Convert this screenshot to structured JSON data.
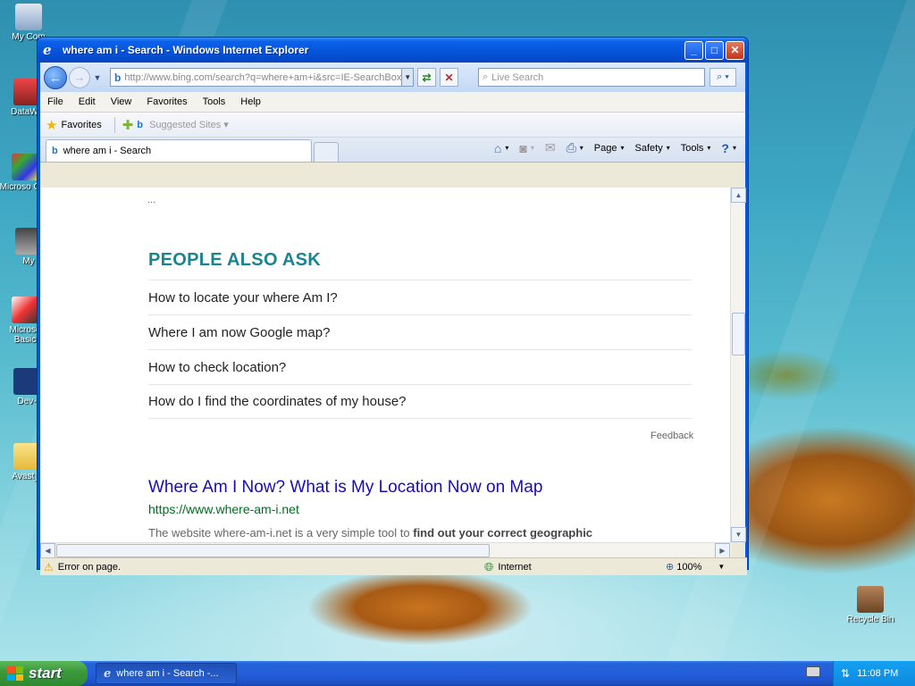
{
  "desktop": {
    "icons": [
      {
        "label": "My Com"
      },
      {
        "label": "DataWa"
      },
      {
        "label": "Microso C++"
      },
      {
        "label": "My"
      },
      {
        "label": "Microso Basic"
      },
      {
        "label": "Dev-"
      },
      {
        "label": "Avast_f"
      },
      {
        "label": "Recycle Bin"
      }
    ]
  },
  "window": {
    "title": "where am i - Search - Windows Internet Explorer",
    "address": "http://www.bing.com/search?q=where+am+i&src=IE-SearchBox",
    "search_placeholder": "Live Search",
    "menu": [
      "File",
      "Edit",
      "View",
      "Favorites",
      "Tools",
      "Help"
    ],
    "favorites_label": "Favorites",
    "suggested_sites": "Suggested Sites",
    "tab_label": "where am i - Search",
    "commands": {
      "page": "Page",
      "safety": "Safety",
      "tools": "Tools"
    }
  },
  "page": {
    "ellipsis": "...",
    "paa_title": "PEOPLE ALSO ASK",
    "paa_items": [
      "How to locate your where Am I?",
      "Where I am now Google map?",
      "How to check location?",
      "How do I find the coordinates of my house?"
    ],
    "feedback": "Feedback",
    "result": {
      "title": "Where Am I Now? What is My Location Now on Map",
      "url": "https://www.where-am-i.net",
      "desc_plain": "The website where-am-i.net is a very simple tool to ",
      "desc_bold": "find out your correct geographic"
    }
  },
  "status": {
    "text": "Error on page.",
    "zone": "Internet",
    "zoom": "100%"
  },
  "taskbar": {
    "start": "start",
    "task": "where am i - Search -...",
    "time": "11:08 PM"
  }
}
